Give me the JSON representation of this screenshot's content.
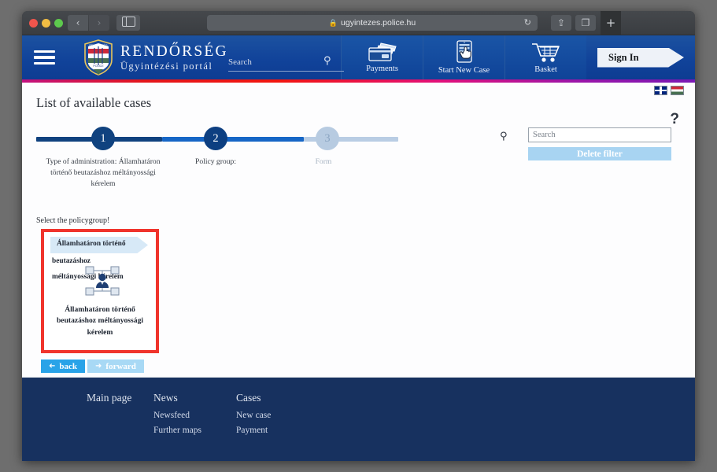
{
  "browser": {
    "url": "ugyintezes.police.hu",
    "lock_icon": "lock-icon",
    "reload_icon": "reload-icon",
    "back_icon": "chevron-left-icon",
    "forward_icon": "chevron-right-icon",
    "sidebar_icon": "sidebar-toggle-icon",
    "share_icon": "share-icon",
    "tabs_icon": "tabs-overview-icon",
    "newtab_label": "+"
  },
  "header": {
    "menu_icon": "hamburger-menu-icon",
    "brand_main": "RENDŐRSÉG",
    "brand_sub": "Ügyintézési portál",
    "crest_icon": "police-crest-icon",
    "search_placeholder": "Search",
    "search_icon": "search-icon",
    "nav_items": [
      {
        "label": "Payments",
        "icon": "wallet-payments-icon"
      },
      {
        "label": "Start New Case",
        "icon": "new-case-tablet-icon"
      },
      {
        "label": "Basket",
        "icon": "shopping-cart-icon"
      }
    ],
    "signin_label": "Sign In"
  },
  "languages": [
    {
      "name": "english-flag",
      "code": "EN"
    },
    {
      "name": "hungarian-flag",
      "code": "HU"
    }
  ],
  "page": {
    "title": "List of available cases",
    "help_label": "?"
  },
  "stepper": {
    "steps": [
      {
        "number": "1",
        "label": "Type of administration: Államhatáron történő beutazáshoz méltányossági kérelem",
        "state": "complete"
      },
      {
        "number": "2",
        "label": "Policy group:",
        "state": "current"
      },
      {
        "number": "3",
        "label": "Form",
        "state": "upcoming"
      }
    ]
  },
  "filter": {
    "search_icon": "search-icon",
    "search_value": "",
    "search_placeholder": "Search",
    "delete_filter_label": "Delete filter"
  },
  "policygroup": {
    "hint": "Select the policygroup!",
    "card": {
      "ribbon_text": "Államhatáron történő",
      "line2": "beutazáshoz",
      "line3": "méltányossági kérelem",
      "icon": "org-hierarchy-icon",
      "caption": "Államhatáron történő beutazáshoz méltányossági kérelem",
      "highlight_color": "#f0342c",
      "selected": true
    }
  },
  "pagination": {
    "back_label": "back",
    "back_icon": "arrow-left-icon",
    "forward_label": "forward",
    "forward_icon": "arrow-right-icon"
  },
  "cursor": {
    "icon": "hand-pointer-cursor"
  },
  "footer": {
    "columns": [
      {
        "head": "Main page",
        "links": []
      },
      {
        "head": "News",
        "links": [
          "Newsfeed",
          "Further maps"
        ]
      },
      {
        "head": "Cases",
        "links": [
          "New case",
          "Payment"
        ]
      }
    ]
  },
  "colors": {
    "brand_blue": "#0d3c92",
    "footer_navy": "#17315f",
    "accent_red": "#f0342c",
    "button_blue": "#29a3e8",
    "step_done": "#10427f",
    "step_current": "#1666c6",
    "step_upcoming": "#b9cde4"
  }
}
